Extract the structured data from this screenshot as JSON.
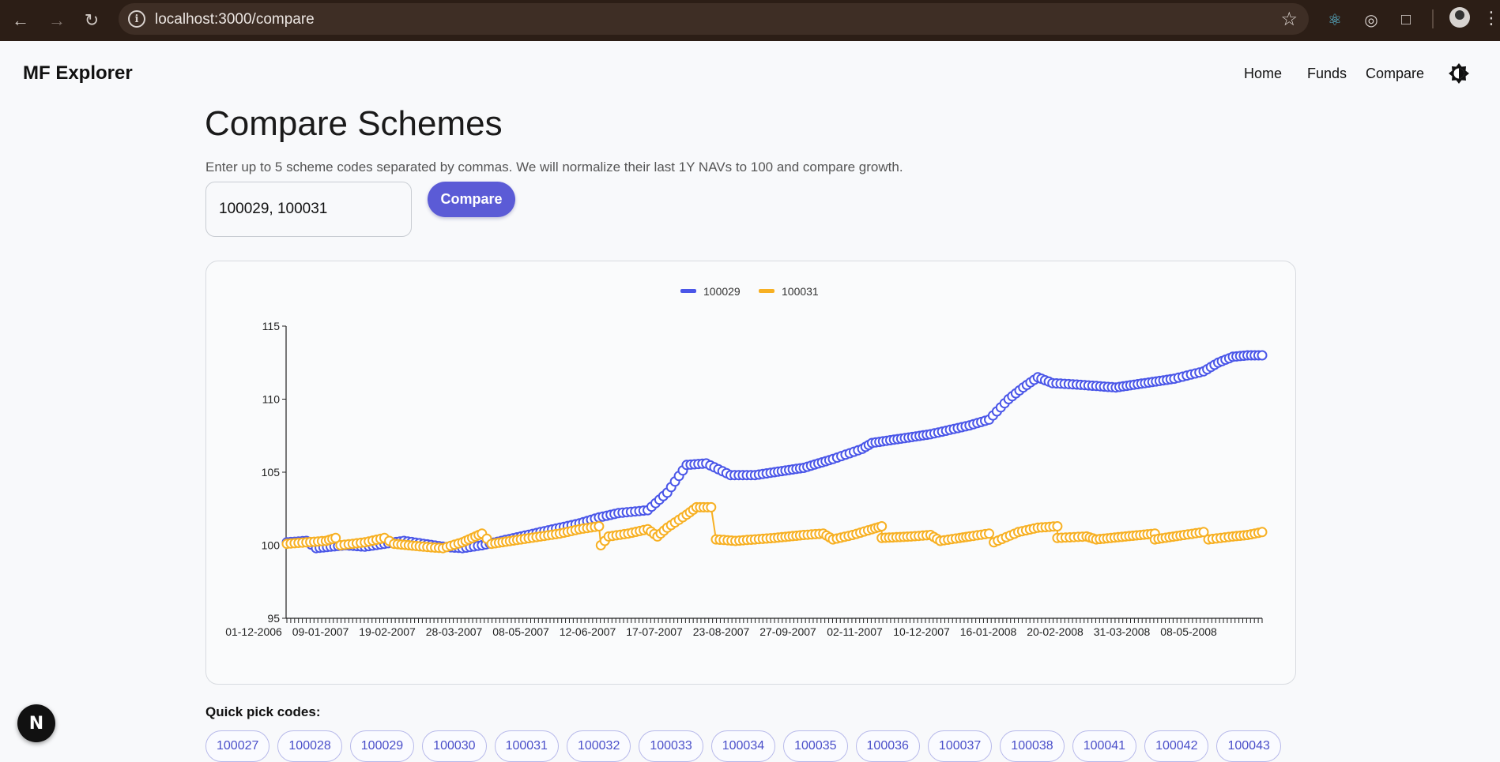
{
  "browser": {
    "url": "localhost:3000/compare"
  },
  "app": {
    "title": "MF Explorer",
    "nav": [
      "Home",
      "Funds",
      "Compare"
    ]
  },
  "page": {
    "title": "Compare Schemes",
    "subtitle": "Enter up to 5 scheme codes separated by commas. We will normalize their last 1Y NAVs to 100 and compare growth.",
    "input_value": "100029, 100031",
    "compare_label": "Compare",
    "quick_pick_label": "Quick pick codes:",
    "quick_pick_codes": [
      "100027",
      "100028",
      "100029",
      "100030",
      "100031",
      "100032",
      "100033",
      "100034",
      "100035",
      "100036",
      "100037",
      "100038",
      "100041",
      "100042",
      "100043"
    ]
  },
  "colors": {
    "series_1": "#4a56e8",
    "series_2": "#f7b023",
    "accent": "#5b5bd6"
  },
  "chart_data": {
    "type": "line",
    "title": "",
    "xlabel": "",
    "ylabel": "",
    "ylim": [
      95,
      115
    ],
    "yticks": [
      "95",
      "100",
      "105",
      "110",
      "115"
    ],
    "xticks": [
      "01-12-2006",
      "09-01-2007",
      "19-02-2007",
      "28-03-2007",
      "08-05-2007",
      "12-06-2007",
      "17-07-2007",
      "23-08-2007",
      "27-09-2007",
      "02-11-2007",
      "10-12-2007",
      "16-01-2008",
      "20-02-2008",
      "31-03-2008",
      "08-05-2008"
    ],
    "legend_position": "top-center",
    "grid": false,
    "series": [
      {
        "name": "100029",
        "points": [
          [
            0,
            100.2
          ],
          [
            0.02,
            100.3
          ],
          [
            0.03,
            99.8
          ],
          [
            0.045,
            99.9
          ],
          [
            0.06,
            100.0
          ],
          [
            0.08,
            99.9
          ],
          [
            0.1,
            100.1
          ],
          [
            0.12,
            100.3
          ],
          [
            0.14,
            100.1
          ],
          [
            0.16,
            99.9
          ],
          [
            0.18,
            99.8
          ],
          [
            0.2,
            100.0
          ],
          [
            0.22,
            100.3
          ],
          [
            0.24,
            100.6
          ],
          [
            0.26,
            100.9
          ],
          [
            0.28,
            101.2
          ],
          [
            0.3,
            101.5
          ],
          [
            0.32,
            101.9
          ],
          [
            0.34,
            102.2
          ],
          [
            0.37,
            102.4
          ],
          [
            0.39,
            103.6
          ],
          [
            0.41,
            105.5
          ],
          [
            0.43,
            105.6
          ],
          [
            0.455,
            104.8
          ],
          [
            0.48,
            104.8
          ],
          [
            0.5,
            105.0
          ],
          [
            0.53,
            105.3
          ],
          [
            0.56,
            105.9
          ],
          [
            0.59,
            106.6
          ],
          [
            0.6,
            107.0
          ],
          [
            0.63,
            107.3
          ],
          [
            0.66,
            107.6
          ],
          [
            0.68,
            107.9
          ],
          [
            0.7,
            108.2
          ],
          [
            0.72,
            108.6
          ],
          [
            0.74,
            110.0
          ],
          [
            0.755,
            110.8
          ],
          [
            0.77,
            111.5
          ],
          [
            0.785,
            111.1
          ],
          [
            0.81,
            111.0
          ],
          [
            0.83,
            110.9
          ],
          [
            0.85,
            110.8
          ],
          [
            0.88,
            111.1
          ],
          [
            0.91,
            111.4
          ],
          [
            0.94,
            111.9
          ],
          [
            0.955,
            112.5
          ],
          [
            0.97,
            112.9
          ],
          [
            0.985,
            113.0
          ],
          [
            1.0,
            113.0
          ]
        ]
      },
      {
        "name": "100031",
        "points": [
          [
            0,
            100.1
          ],
          [
            0.02,
            100.2
          ],
          [
            0.04,
            100.3
          ],
          [
            0.05,
            100.5
          ],
          [
            0.055,
            100.0
          ],
          [
            0.08,
            100.2
          ],
          [
            0.1,
            100.5
          ],
          [
            0.11,
            100.1
          ],
          [
            0.14,
            99.9
          ],
          [
            0.16,
            99.8
          ],
          [
            0.18,
            100.2
          ],
          [
            0.19,
            100.5
          ],
          [
            0.2,
            100.8
          ],
          [
            0.21,
            100.1
          ],
          [
            0.24,
            100.4
          ],
          [
            0.26,
            100.6
          ],
          [
            0.28,
            100.8
          ],
          [
            0.3,
            101.1
          ],
          [
            0.32,
            101.3
          ],
          [
            0.322,
            100.0
          ],
          [
            0.33,
            100.6
          ],
          [
            0.35,
            100.8
          ],
          [
            0.37,
            101.1
          ],
          [
            0.38,
            100.6
          ],
          [
            0.39,
            101.2
          ],
          [
            0.41,
            102.1
          ],
          [
            0.42,
            102.6
          ],
          [
            0.435,
            102.6
          ],
          [
            0.44,
            100.4
          ],
          [
            0.46,
            100.3
          ],
          [
            0.5,
            100.5
          ],
          [
            0.53,
            100.7
          ],
          [
            0.55,
            100.8
          ],
          [
            0.56,
            100.4
          ],
          [
            0.58,
            100.7
          ],
          [
            0.6,
            101.1
          ],
          [
            0.61,
            101.3
          ],
          [
            0.61,
            100.5
          ],
          [
            0.64,
            100.6
          ],
          [
            0.66,
            100.7
          ],
          [
            0.67,
            100.3
          ],
          [
            0.69,
            100.5
          ],
          [
            0.7,
            100.6
          ],
          [
            0.72,
            100.8
          ],
          [
            0.725,
            100.2
          ],
          [
            0.75,
            100.9
          ],
          [
            0.77,
            101.2
          ],
          [
            0.79,
            101.3
          ],
          [
            0.79,
            100.5
          ],
          [
            0.82,
            100.6
          ],
          [
            0.83,
            100.4
          ],
          [
            0.86,
            100.6
          ],
          [
            0.89,
            100.8
          ],
          [
            0.89,
            100.4
          ],
          [
            0.92,
            100.7
          ],
          [
            0.94,
            100.9
          ],
          [
            0.945,
            100.4
          ],
          [
            0.97,
            100.6
          ],
          [
            0.985,
            100.7
          ],
          [
            1.0,
            100.9
          ]
        ]
      }
    ]
  }
}
